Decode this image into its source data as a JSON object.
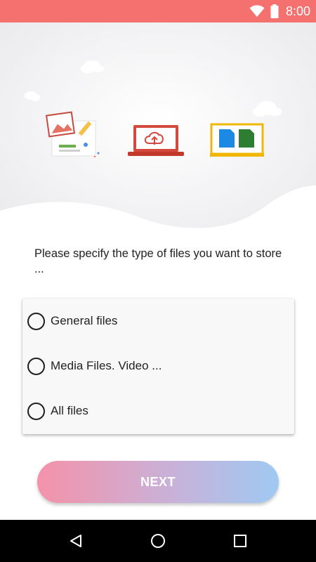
{
  "status_bar": {
    "time": "8:00",
    "icons": [
      "wifi-icon",
      "battery-icon"
    ],
    "color": "#f4716f"
  },
  "hero": {
    "icons": [
      "cloud-icon",
      "image-edit-icon",
      "laptop-cloud-sync-icon",
      "folder-files-icon"
    ]
  },
  "prompt": {
    "text": "Please specify the type of files you want to store ..."
  },
  "options": [
    {
      "label": "General files",
      "selected": false
    },
    {
      "label": "Media Files. Video ...",
      "selected": false
    },
    {
      "label": "All files",
      "selected": false
    }
  ],
  "next_button": {
    "label": "NEXT",
    "gradient": [
      "#f492a9",
      "#c9b1d8",
      "#9fc9f2"
    ]
  },
  "nav_bar": {
    "buttons": [
      "back-icon",
      "home-icon",
      "recents-icon"
    ]
  }
}
